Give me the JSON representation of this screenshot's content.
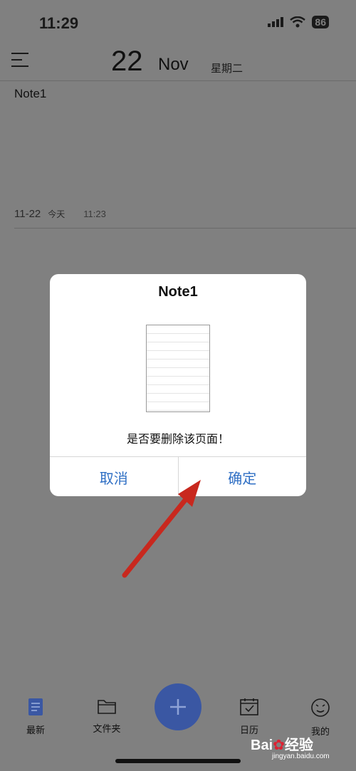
{
  "status_bar": {
    "time": "11:29",
    "battery": "86"
  },
  "header": {
    "day": "22",
    "month": "Nov",
    "weekday": "星期二"
  },
  "note": {
    "title": "Note1",
    "date": "11-22",
    "today_label": "今天",
    "time": "11:23"
  },
  "dialog": {
    "title": "Note1",
    "message": "是否要删除该页面！",
    "cancel_label": "取消",
    "confirm_label": "确定"
  },
  "tabbar": {
    "recent": "最新",
    "folders": "文件夹",
    "calendar": "日历",
    "mine": "我的"
  },
  "watermark": {
    "brand_left": "Bai",
    "brand_right": "经验",
    "site": "jingyan.baidu.com"
  },
  "colors": {
    "accent": "#2f6fc4",
    "fab": "#3a57a3",
    "arrow": "#c8281e"
  }
}
